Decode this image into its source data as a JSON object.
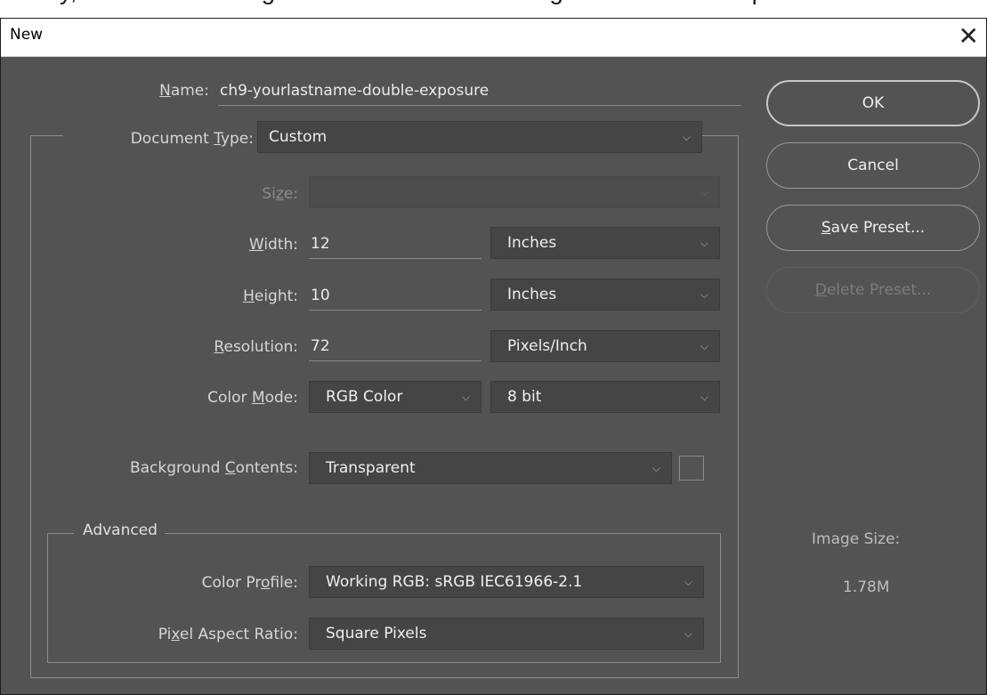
{
  "caption": "Finally, in the New dialog box as shown in the image below set the options as shown",
  "dialog": {
    "title": "New",
    "close_glyph": "✕"
  },
  "form": {
    "name": {
      "label_pre": "",
      "label_u": "N",
      "label_post": "ame:",
      "value": "ch9-yourlastname-double-exposure"
    },
    "document_type": {
      "label_pre": "Document ",
      "label_u": "T",
      "label_post": "ype:",
      "value": "Custom"
    },
    "size": {
      "label_pre": "Si",
      "label_u": "z",
      "label_post": "e:",
      "value": ""
    },
    "width": {
      "label_pre": "",
      "label_u": "W",
      "label_post": "idth:",
      "value": "12",
      "unit": "Inches"
    },
    "height": {
      "label_pre": "",
      "label_u": "H",
      "label_post": "eight:",
      "value": "10",
      "unit": "Inches"
    },
    "resolution": {
      "label_pre": "",
      "label_u": "R",
      "label_post": "esolution:",
      "value": "72",
      "unit": "Pixels/Inch"
    },
    "color_mode": {
      "label_pre": "Color ",
      "label_u": "M",
      "label_post": "ode:",
      "mode": "RGB Color",
      "depth": "8 bit"
    },
    "background_contents": {
      "label_pre": "Background ",
      "label_u": "C",
      "label_post": "ontents:",
      "value": "Transparent"
    },
    "advanced": {
      "title": "Advanced",
      "color_profile": {
        "label_pre": "Color Pr",
        "label_u": "o",
        "label_post": "file:",
        "value": "Working RGB:  sRGB IEC61966-2.1"
      },
      "pixel_aspect_ratio": {
        "label_pre": "Pi",
        "label_u": "x",
        "label_post": "el Aspect Ratio:",
        "value": "Square Pixels"
      }
    }
  },
  "buttons": {
    "ok": "OK",
    "cancel": "Cancel",
    "save_preset_u": "S",
    "save_preset_rest": "ave Preset...",
    "delete_preset_u": "D",
    "delete_preset_rest": "elete Preset..."
  },
  "image_size": {
    "label": "Image Size:",
    "value": "1.78M"
  },
  "icons": {
    "chevron": "⌵",
    "close": "close-icon",
    "dropdown": "chevron-down-icon"
  },
  "colors": {
    "dialog_bg": "#535353",
    "field_bg": "#454545",
    "label": "#d6d6d6"
  }
}
